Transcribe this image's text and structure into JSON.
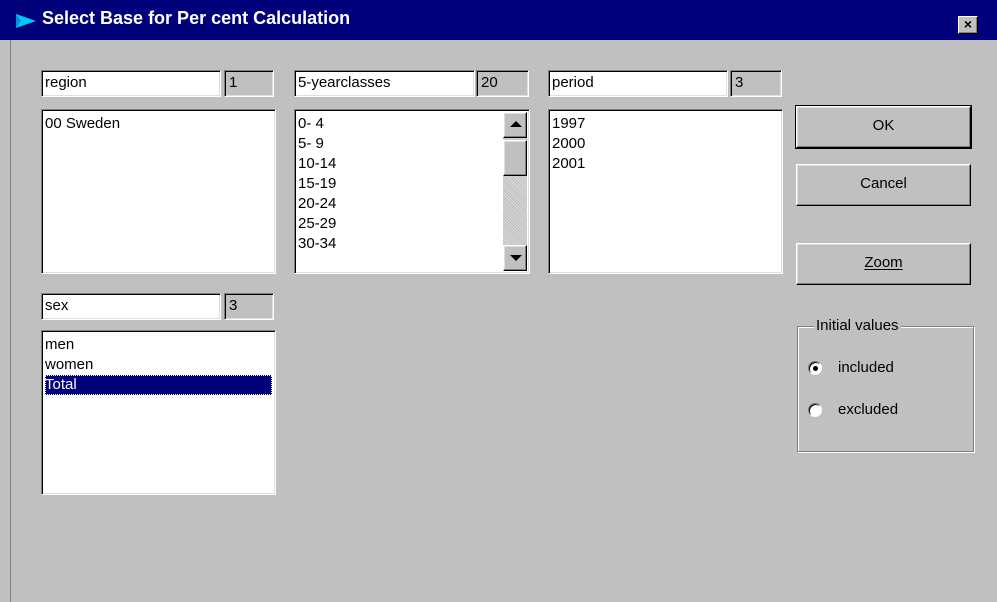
{
  "window": {
    "title": "Select Base for Per cent Calculation",
    "close_label": "×"
  },
  "variables": [
    {
      "name": "region",
      "count": "1",
      "items": [
        "00 Sweden"
      ]
    },
    {
      "name": "5-yearclasses",
      "count": "20",
      "items": [
        "0- 4",
        "5- 9",
        "10-14",
        "15-19",
        "20-24",
        "25-29",
        "30-34"
      ]
    },
    {
      "name": "period",
      "count": "3",
      "items": [
        "1997",
        "2000",
        "2001"
      ]
    },
    {
      "name": "sex",
      "count": "3",
      "items": [
        "men",
        "women",
        "Total"
      ],
      "selected": "Total"
    }
  ],
  "buttons": {
    "ok": "OK",
    "cancel": "Cancel",
    "zoom": "Zoom"
  },
  "initial_values": {
    "legend": "Initial values",
    "options": [
      "included",
      "excluded"
    ],
    "selected": "included"
  },
  "colors": {
    "titlebar": "#00007b",
    "face": "#c0c0c0",
    "selection": "#00007b"
  }
}
